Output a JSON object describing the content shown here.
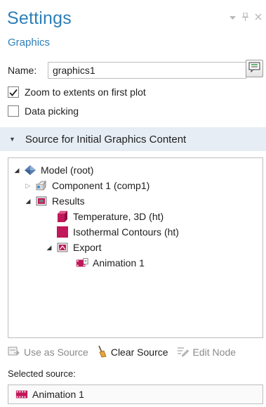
{
  "header": {
    "title": "Settings",
    "subtitle": "Graphics",
    "controls": [
      "dropdown-icon",
      "pin-icon",
      "close-icon"
    ]
  },
  "name_field": {
    "label": "Name:",
    "value": "graphics1"
  },
  "options": {
    "zoom_label": "Zoom to extents on first plot",
    "zoom_checked": true,
    "picking_label": "Data picking",
    "picking_checked": false
  },
  "section": {
    "title": "Source for Initial Graphics Content"
  },
  "tree": {
    "model": "Model (root)",
    "component": "Component 1 (comp1)",
    "results": "Results",
    "temperature": "Temperature, 3D (ht)",
    "isothermal": "Isothermal Contours (ht)",
    "export": "Export",
    "animation": "Animation 1"
  },
  "toolbar": {
    "use_as_source": "Use as Source",
    "clear_source": "Clear Source",
    "edit_node": "Edit Node"
  },
  "selected": {
    "label": "Selected source:",
    "value": "Animation 1"
  },
  "colors": {
    "title": "#2d7fb8",
    "section_bg": "#e6edf4",
    "result_red": "#c0185a"
  }
}
